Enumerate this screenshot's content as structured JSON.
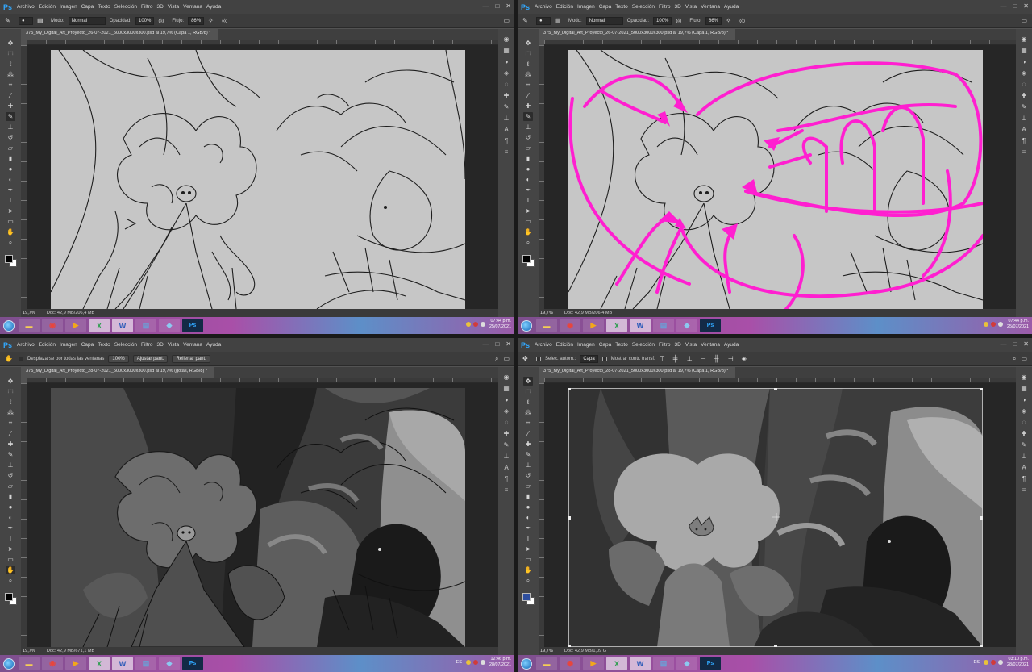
{
  "app": {
    "logo": "Ps",
    "window_controls": [
      "—",
      "□",
      "✕"
    ]
  },
  "menu": [
    "Archivo",
    "Edición",
    "Imagen",
    "Capa",
    "Texto",
    "Selección",
    "Filtro",
    "3D",
    "Vista",
    "Ventana",
    "Ayuda"
  ],
  "colors": {
    "annotation": "#ff1fd0",
    "ps_blue": "#31a8ff",
    "canvas_sketch": "#c9c9c9"
  },
  "icons": {
    "tools": [
      "move-icon",
      "marquee-icon",
      "lasso-icon",
      "magic-wand-icon",
      "crop-icon",
      "eyedropper-icon",
      "healing-icon",
      "brush-icon",
      "clone-stamp-icon",
      "history-brush-icon",
      "eraser-icon",
      "gradient-icon",
      "blur-icon",
      "dodge-icon",
      "pen-icon",
      "type-icon",
      "path-select-icon",
      "shape-icon",
      "hand-icon",
      "zoom-icon"
    ],
    "right_panel": [
      "color-panel-icon",
      "swatches-icon",
      "adjustments-icon",
      "layers-icon",
      "channels-icon",
      "paths-icon",
      "brush-preset-icon",
      "clone-source-icon",
      "character-icon",
      "paragraph-icon",
      "properties-icon"
    ]
  },
  "windows": [
    {
      "options_variant": "brush",
      "options": {
        "mode_label": "Modo:",
        "mode_value": "Normal",
        "opacity_label": "Opacidad:",
        "opacity_value": "100%",
        "flow_label": "Flujo:",
        "flow_value": "86%"
      },
      "tab": "375_My_Digital_Art_Proyecto_26-07-2021_5000x3000x300.psd al 19,7% (Capa 1, RGB/8) *",
      "status": {
        "zoom": "19,7%",
        "doc": "Doc: 42,9 MB/206,4 MB"
      },
      "clock": {
        "time": "07:44 p.m.",
        "date": "25/07/2021",
        "lang": ""
      },
      "art_variant": "sketch"
    },
    {
      "options_variant": "brush",
      "options": {
        "mode_label": "Modo:",
        "mode_value": "Normal",
        "opacity_label": "Opacidad:",
        "opacity_value": "100%",
        "flow_label": "Flujo:",
        "flow_value": "86%"
      },
      "tab": "375_My_Digital_Art_Proyecto_26-07-2021_5000x3000x300.psd al 19,7% (Capa 1, RGB/8) *",
      "status": {
        "zoom": "19,7%",
        "doc": "Doc: 42,9 MB/206,4 MB"
      },
      "clock": {
        "time": "07:44 p.m.",
        "date": "25/07/2021",
        "lang": ""
      },
      "art_variant": "sketch-arrows"
    },
    {
      "options_variant": "hand",
      "options": {
        "scroll_all_label": "Desplazarse por todas las ventanas",
        "zoom_value": "100%",
        "fit_btn": "Ajustar pant.",
        "fill_btn": "Rellenar pant."
      },
      "tab": "375_My_Digital_Art_Proyecto_28-07-2021_5000x3000x300.psd al 19,7% (gotas, RGB/8) *",
      "status": {
        "zoom": "19,7%",
        "doc": "Doc: 42,9 MB/671,1 MB"
      },
      "clock": {
        "time": "12:46 p.m.",
        "date": "28/07/2021",
        "lang": "ES"
      },
      "art_variant": "values-lines"
    },
    {
      "options_variant": "move",
      "options": {
        "auto_select_label": "Selec. autom.:",
        "auto_select_value": "Capa",
        "transform_label": "Mostrar contr. transf."
      },
      "tab": "375_My_Digital_Art_Proyecto_28-07-2021_5000x3000x300.psd al 19,7% (Capa 1, RGB/8) *",
      "status": {
        "zoom": "19,7%",
        "doc": "Doc: 42,9 MB/1,09 G"
      },
      "clock": {
        "time": "03:10 p.m.",
        "date": "28/07/2021",
        "lang": "ES"
      },
      "art_variant": "values-flat"
    }
  ]
}
